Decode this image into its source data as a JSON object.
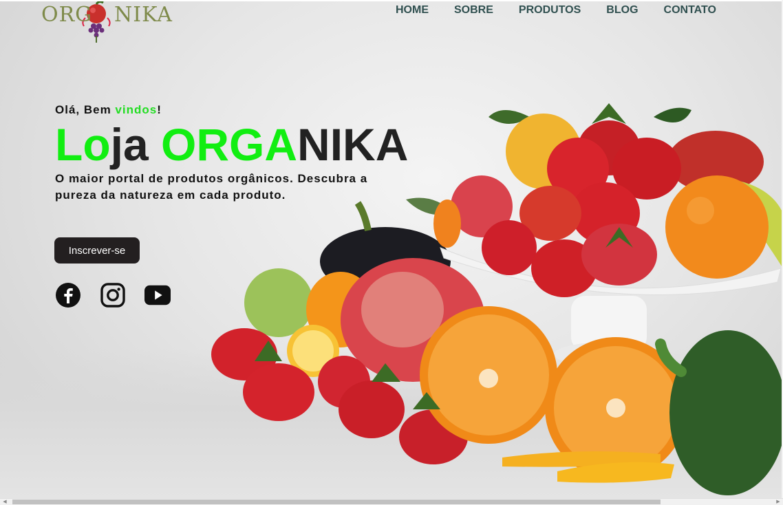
{
  "brand": {
    "logo_text": "ORGANIKA"
  },
  "nav": {
    "items": [
      {
        "label": "HOME"
      },
      {
        "label": "SOBRE"
      },
      {
        "label": "PRODUTOS"
      },
      {
        "label": "BLOG"
      },
      {
        "label": "CONTATO"
      }
    ]
  },
  "hero": {
    "greeting_prefix": "Olá, Bem ",
    "greeting_highlight": "vindos",
    "greeting_suffix": "!",
    "headline_parts": [
      "Lo",
      "ja",
      " ",
      "ORGA",
      "NIKA"
    ],
    "description": "O maior portal de produtos orgânicos. Descubra a pureza da natureza em cada produto.",
    "cta_label": "Inscrever-se"
  },
  "socials": [
    {
      "icon": "facebook-icon"
    },
    {
      "icon": "instagram-icon"
    },
    {
      "icon": "youtube-icon"
    }
  ],
  "colors": {
    "accent_green": "#11ee11",
    "nav_text": "#2f4f4f",
    "button_bg": "#231f20"
  }
}
